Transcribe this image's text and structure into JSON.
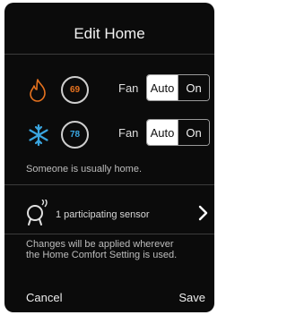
{
  "header": {
    "title": "Edit Home"
  },
  "heat": {
    "icon": "flame-icon",
    "temperature": "69",
    "color": "#e8731f",
    "fan_label": "Fan",
    "fan_options": [
      "Auto",
      "On"
    ],
    "fan_selected": "Auto"
  },
  "cool": {
    "icon": "snowflake-icon",
    "temperature": "78",
    "color": "#3aa6e0",
    "fan_label": "Fan",
    "fan_options": [
      "Auto",
      "On"
    ],
    "fan_selected": "Auto"
  },
  "occupancy_text": "Someone is usually home.",
  "sensor": {
    "icon": "sensor-icon",
    "label": "1 participating sensor",
    "chevron": "chevron-right-icon"
  },
  "info_text": {
    "line1": "Changes will be applied wherever",
    "line2": "the Home Comfort Setting is used."
  },
  "footer": {
    "cancel_label": "Cancel",
    "save_label": "Save"
  }
}
